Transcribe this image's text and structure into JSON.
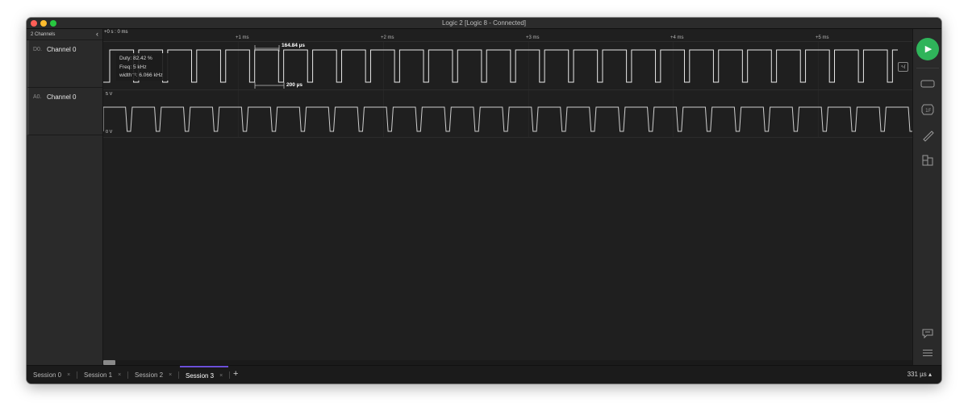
{
  "window": {
    "title": "Logic 2 [Logic 8 - Connected]"
  },
  "sidebar": {
    "header_label": "2 Channels",
    "channels": [
      {
        "id": "D0.",
        "name": "Channel 0"
      },
      {
        "id": "A0.",
        "name": "Channel 0"
      }
    ]
  },
  "timeline": {
    "origin_label": "+0 s : 0 ms",
    "ticks": [
      "+1 ms",
      "+2 ms",
      "+3 ms",
      "+4 ms",
      "+5 ms"
    ]
  },
  "measurement": {
    "duty": "Duty: 82.42 %",
    "freq": "Freq: 5 kHz",
    "width": "width⁻¹: 6.066 kHz",
    "pulse_width": "164.84 µs",
    "period": "200 µs"
  },
  "analog": {
    "v_high": "5 V",
    "v_low": "0 V"
  },
  "lane_badge": "∿∫",
  "tabs": [
    {
      "label": "Session 0",
      "close": "×"
    },
    {
      "label": "Session 1",
      "close": "×"
    },
    {
      "label": "Session 2",
      "close": "×"
    },
    {
      "label": "Session 3",
      "close": "×",
      "active": true
    }
  ],
  "add_tab": "+",
  "zoom_label": "331 µs ▴",
  "colors": {
    "accent": "#6b4fd8",
    "play": "#2fb45a",
    "background": "#1e1e1e"
  },
  "icons": [
    "play-icon",
    "analyzers-icon",
    "extensions-icon",
    "measure-icon",
    "layout-icon",
    "comment-icon",
    "menu-icon"
  ]
}
